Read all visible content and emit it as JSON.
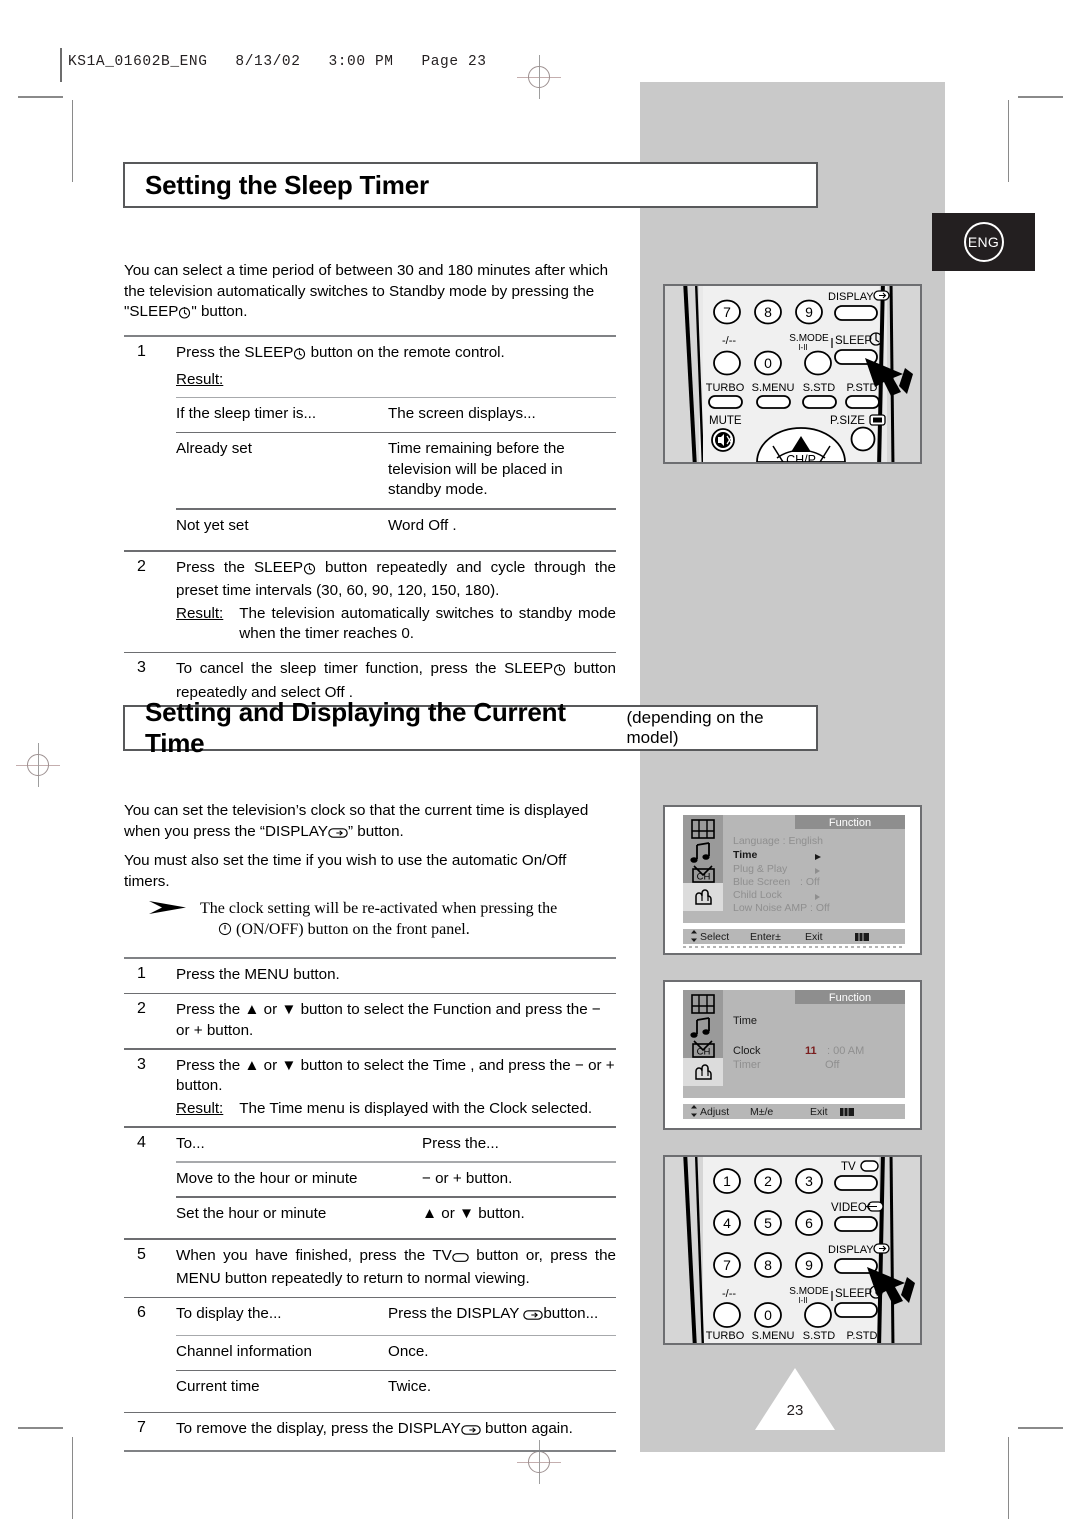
{
  "print_header": {
    "text": "KS1A_01602B_ENG   8/13/02   3:00 PM   Page 23"
  },
  "language_tab": {
    "label": "ENG"
  },
  "page_number": "23",
  "sections": [
    {
      "title": "Setting the Sleep Timer",
      "subtitle": "",
      "intro": "You can select a time period of between 30 and 180 minutes after which the television automatically switches to Standby mode by pressing the \"SLEEP",
      "intro_tail": "\" button.",
      "steps": [
        {
          "num": "1",
          "text_a": "Press the SLEEP",
          "text_b": "button on the remote control.",
          "result_label": "Result:",
          "table": {
            "headers": [
              "If the sleep timer is...",
              "The screen displays..."
            ],
            "rows": [
              [
                "Already set",
                "Time remaining before the television will be placed in standby mode."
              ],
              [
                "Not yet set",
                "Word  Off ."
              ]
            ]
          }
        },
        {
          "num": "2",
          "text_a": "Press the SLEEP",
          "text_b": "button repeatedly and cycle through the preset time intervals (30, 60, 90, 120, 150, 180).",
          "result_label": "Result:",
          "result_text": "The television automatically switches to standby mode when the timer reaches 0."
        },
        {
          "num": "3",
          "text_a": "To cancel the sleep timer function, press the SLEEP",
          "text_b": "button repeatedly and select  Off ."
        }
      ]
    },
    {
      "title": "Setting and Displaying the Current Time",
      "subtitle": "(depending on the model)",
      "intro_1a": "You can set the television’s clock so that the current time is displayed when you press the “DISPLAY",
      "intro_1b": "” button.",
      "intro_2": "You must also set the time if you wish to use the automatic On/Off timers.",
      "note_line1": "The clock setting will be re-activated when pressing the",
      "note_line2": "(ON/OFF) button on the front panel.",
      "steps": [
        {
          "num": "1",
          "text": "Press the MENU button."
        },
        {
          "num": "2",
          "text": "Press the ▲ or ▼ button to select the  Function  and press the − or + button."
        },
        {
          "num": "3",
          "text": "Press the ▲ or ▼ button to select the  Time , and press the − or + button.",
          "result_label": "Result:",
          "result_text": "The  Time  menu is displayed with the  Clock  selected."
        },
        {
          "num": "4",
          "table": {
            "headers": [
              "To...",
              "Press the..."
            ],
            "rows": [
              [
                "Move to the hour or minute",
                "− or + button."
              ],
              [
                "Set the hour or minute",
                "▲ or ▼ button."
              ]
            ]
          }
        },
        {
          "num": "5",
          "text_a": "When you have finished, press the TV",
          "text_b": "button or, press the MENU button repeatedly to return to normal viewing."
        },
        {
          "num": "6",
          "table": {
            "headers": [
              "To display the...",
              "Press the DISPLAY"
            ],
            "header_tail": "button...",
            "rows": [
              [
                "Channel information",
                "Once."
              ],
              [
                "Current time",
                "Twice."
              ]
            ]
          }
        },
        {
          "num": "7",
          "text_a": "To remove the display, press the DISPLAY",
          "text_b": "button again."
        }
      ]
    }
  ],
  "illustrations": {
    "remote_top": {
      "name": "remote-control-sleep",
      "number_keys": [
        "7",
        "8",
        "9",
        "0"
      ],
      "labels": {
        "display": "DISPLAY",
        "sleep": "SLEEP",
        "minus_dash": "-/--",
        "smode": "S.MODE",
        "smode_sub": "I-II",
        "turbo": "TURBO",
        "smenu": "S.MENU",
        "sstd": "S.STD",
        "pstd": "P.STD",
        "mute": "MUTE",
        "psize": "P.SIZE",
        "chp": "CH/P"
      }
    },
    "remote_bottom": {
      "name": "remote-control-display",
      "number_keys": [
        "1",
        "2",
        "3",
        "4",
        "5",
        "6",
        "7",
        "8",
        "9",
        "0"
      ],
      "labels": {
        "tv": "TV",
        "video": "VIDEO",
        "display": "DISPLAY",
        "sleep": "SLEEP",
        "minus_dash": "-/--",
        "smode": "S.MODE",
        "smode_sub": "I-II",
        "turbo": "TURBO",
        "smenu": "S.MENU",
        "sstd": "S.STD",
        "pstd": "P.STD"
      }
    },
    "osd_function": {
      "title": "Function",
      "items": [
        {
          "label": "Language : English",
          "selected": false,
          "arrow": false
        },
        {
          "label": "Time",
          "selected": true,
          "arrow": true
        },
        {
          "label": "Plug & Play",
          "selected": false,
          "arrow": true
        },
        {
          "label": "Blue Screen",
          "value": ": Off",
          "selected": false,
          "arrow": false
        },
        {
          "label": "Child Lock",
          "selected": false,
          "arrow": true
        },
        {
          "label": "Low Noise AMP",
          "value": ": Off",
          "selected": false,
          "arrow": false
        }
      ],
      "footer": [
        "Select",
        "Enter±",
        "Exit"
      ],
      "sidebar_icons": [
        "picture-icon",
        "sound-icon",
        "channel-icon",
        "function-icon"
      ]
    },
    "osd_time": {
      "title": "Function",
      "heading": "Time",
      "rows": [
        {
          "label": "Clock",
          "value_hour": "11",
          "value_rest": ": 00  AM",
          "highlight": true
        },
        {
          "label": "Timer",
          "value_rest": "Off",
          "highlight": false
        }
      ],
      "footer": [
        "Adjust",
        "M±/e",
        "Exit"
      ],
      "sidebar_icons": [
        "picture-icon",
        "sound-icon",
        "channel-icon",
        "function-icon"
      ]
    }
  },
  "colors": {
    "panel_grey": "#c9c9c9",
    "rule_grey": "#808285",
    "osd_grey": "#b4b4b4",
    "osd_dark": "#8e8e8e",
    "highlight_red": "#7a1d1d",
    "black": "#231f20"
  }
}
